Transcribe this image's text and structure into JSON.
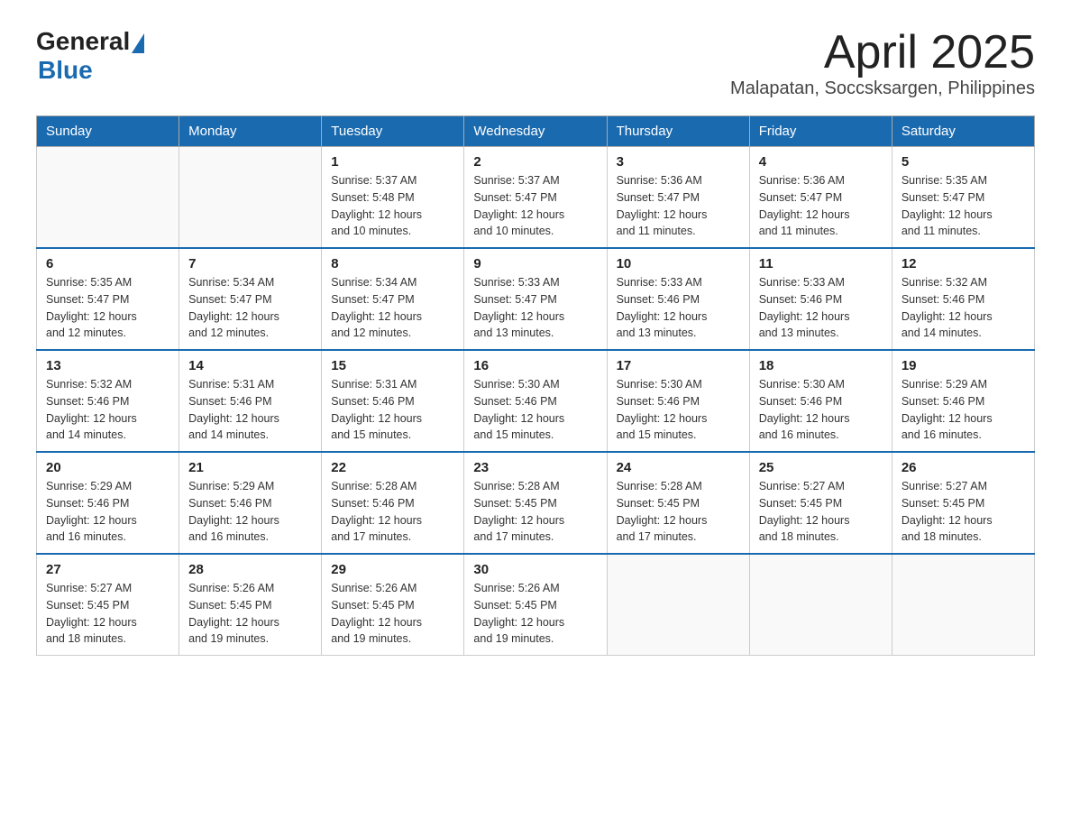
{
  "header": {
    "logo_general": "General",
    "logo_blue": "Blue",
    "title": "April 2025",
    "subtitle": "Malapatan, Soccsksargen, Philippines"
  },
  "days_of_week": [
    "Sunday",
    "Monday",
    "Tuesday",
    "Wednesday",
    "Thursday",
    "Friday",
    "Saturday"
  ],
  "weeks": [
    [
      {
        "day": "",
        "info": ""
      },
      {
        "day": "",
        "info": ""
      },
      {
        "day": "1",
        "info": "Sunrise: 5:37 AM\nSunset: 5:48 PM\nDaylight: 12 hours\nand 10 minutes."
      },
      {
        "day": "2",
        "info": "Sunrise: 5:37 AM\nSunset: 5:47 PM\nDaylight: 12 hours\nand 10 minutes."
      },
      {
        "day": "3",
        "info": "Sunrise: 5:36 AM\nSunset: 5:47 PM\nDaylight: 12 hours\nand 11 minutes."
      },
      {
        "day": "4",
        "info": "Sunrise: 5:36 AM\nSunset: 5:47 PM\nDaylight: 12 hours\nand 11 minutes."
      },
      {
        "day": "5",
        "info": "Sunrise: 5:35 AM\nSunset: 5:47 PM\nDaylight: 12 hours\nand 11 minutes."
      }
    ],
    [
      {
        "day": "6",
        "info": "Sunrise: 5:35 AM\nSunset: 5:47 PM\nDaylight: 12 hours\nand 12 minutes."
      },
      {
        "day": "7",
        "info": "Sunrise: 5:34 AM\nSunset: 5:47 PM\nDaylight: 12 hours\nand 12 minutes."
      },
      {
        "day": "8",
        "info": "Sunrise: 5:34 AM\nSunset: 5:47 PM\nDaylight: 12 hours\nand 12 minutes."
      },
      {
        "day": "9",
        "info": "Sunrise: 5:33 AM\nSunset: 5:47 PM\nDaylight: 12 hours\nand 13 minutes."
      },
      {
        "day": "10",
        "info": "Sunrise: 5:33 AM\nSunset: 5:46 PM\nDaylight: 12 hours\nand 13 minutes."
      },
      {
        "day": "11",
        "info": "Sunrise: 5:33 AM\nSunset: 5:46 PM\nDaylight: 12 hours\nand 13 minutes."
      },
      {
        "day": "12",
        "info": "Sunrise: 5:32 AM\nSunset: 5:46 PM\nDaylight: 12 hours\nand 14 minutes."
      }
    ],
    [
      {
        "day": "13",
        "info": "Sunrise: 5:32 AM\nSunset: 5:46 PM\nDaylight: 12 hours\nand 14 minutes."
      },
      {
        "day": "14",
        "info": "Sunrise: 5:31 AM\nSunset: 5:46 PM\nDaylight: 12 hours\nand 14 minutes."
      },
      {
        "day": "15",
        "info": "Sunrise: 5:31 AM\nSunset: 5:46 PM\nDaylight: 12 hours\nand 15 minutes."
      },
      {
        "day": "16",
        "info": "Sunrise: 5:30 AM\nSunset: 5:46 PM\nDaylight: 12 hours\nand 15 minutes."
      },
      {
        "day": "17",
        "info": "Sunrise: 5:30 AM\nSunset: 5:46 PM\nDaylight: 12 hours\nand 15 minutes."
      },
      {
        "day": "18",
        "info": "Sunrise: 5:30 AM\nSunset: 5:46 PM\nDaylight: 12 hours\nand 16 minutes."
      },
      {
        "day": "19",
        "info": "Sunrise: 5:29 AM\nSunset: 5:46 PM\nDaylight: 12 hours\nand 16 minutes."
      }
    ],
    [
      {
        "day": "20",
        "info": "Sunrise: 5:29 AM\nSunset: 5:46 PM\nDaylight: 12 hours\nand 16 minutes."
      },
      {
        "day": "21",
        "info": "Sunrise: 5:29 AM\nSunset: 5:46 PM\nDaylight: 12 hours\nand 16 minutes."
      },
      {
        "day": "22",
        "info": "Sunrise: 5:28 AM\nSunset: 5:46 PM\nDaylight: 12 hours\nand 17 minutes."
      },
      {
        "day": "23",
        "info": "Sunrise: 5:28 AM\nSunset: 5:45 PM\nDaylight: 12 hours\nand 17 minutes."
      },
      {
        "day": "24",
        "info": "Sunrise: 5:28 AM\nSunset: 5:45 PM\nDaylight: 12 hours\nand 17 minutes."
      },
      {
        "day": "25",
        "info": "Sunrise: 5:27 AM\nSunset: 5:45 PM\nDaylight: 12 hours\nand 18 minutes."
      },
      {
        "day": "26",
        "info": "Sunrise: 5:27 AM\nSunset: 5:45 PM\nDaylight: 12 hours\nand 18 minutes."
      }
    ],
    [
      {
        "day": "27",
        "info": "Sunrise: 5:27 AM\nSunset: 5:45 PM\nDaylight: 12 hours\nand 18 minutes."
      },
      {
        "day": "28",
        "info": "Sunrise: 5:26 AM\nSunset: 5:45 PM\nDaylight: 12 hours\nand 19 minutes."
      },
      {
        "day": "29",
        "info": "Sunrise: 5:26 AM\nSunset: 5:45 PM\nDaylight: 12 hours\nand 19 minutes."
      },
      {
        "day": "30",
        "info": "Sunrise: 5:26 AM\nSunset: 5:45 PM\nDaylight: 12 hours\nand 19 minutes."
      },
      {
        "day": "",
        "info": ""
      },
      {
        "day": "",
        "info": ""
      },
      {
        "day": "",
        "info": ""
      }
    ]
  ]
}
